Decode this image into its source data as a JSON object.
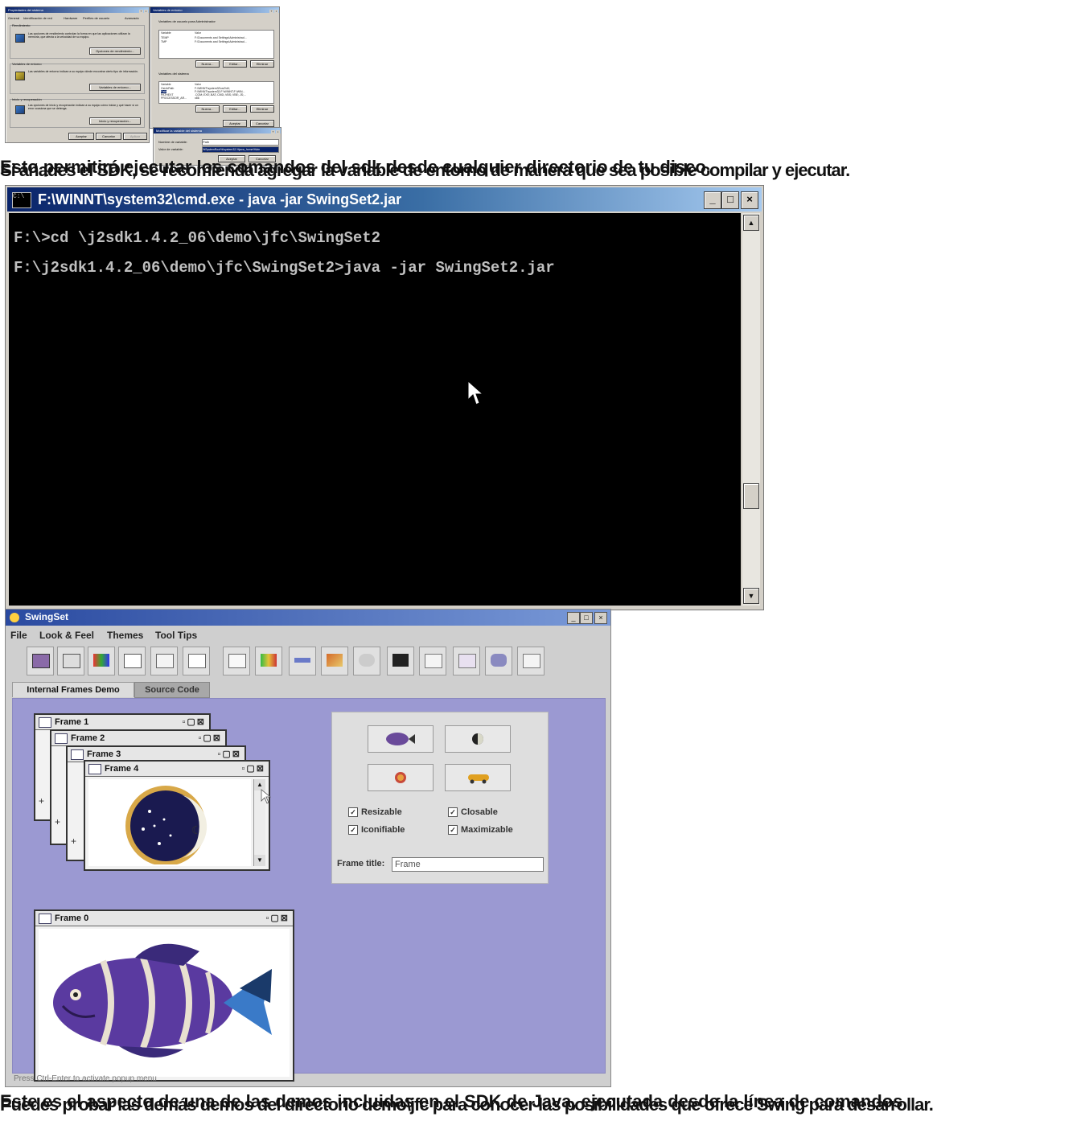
{
  "top_dialogs": {
    "system_properties": {
      "title": "Propiedades del sistema",
      "tabs": [
        "General",
        "Identificación de red",
        "Hardware",
        "Perfiles de usuario",
        "Avanzado"
      ],
      "performance_label": "Rendimiento",
      "performance_text": "Las opciones de rendimiento controlan la forma en que las aplicaciones utilizan la memoria, que afecta a la velocidad de su equipo.",
      "performance_button": "Opciones de rendimiento...",
      "env_label": "Variables de entorno",
      "env_text": "Las variables de entorno indican a su equipo dónde encontrar cierto tipo de información.",
      "env_button": "Variables de entorno...",
      "startup_label": "Inicio y recuperación",
      "startup_text": "Las opciones de inicio y recuperación indican a su equipo cómo iniciar y qué hacer si un error ocasiona que se detenga.",
      "startup_button": "Inicio y recuperación...",
      "ok": "Aceptar",
      "cancel": "Cancelar",
      "apply": "Aplicar"
    },
    "env_vars": {
      "title": "Variables de entorno",
      "user_label": "Variables de usuario para Administrador",
      "col_variable": "Variable",
      "col_value": "Valor",
      "user_rows": [
        {
          "name": "TEMP",
          "value": "F:\\Documents and Settings\\Administrad..."
        },
        {
          "name": "TMP",
          "value": "F:\\Documents and Settings\\Administrad..."
        }
      ],
      "new": "Nueva...",
      "edit": "Editar...",
      "delete": "Eliminar",
      "system_label": "Variables del sistema",
      "system_rows": [
        {
          "name": "OsLibPath",
          "value": "F:\\WINNT\\system32\\os2\\dll;"
        },
        {
          "name": "Path",
          "value": "F:\\WINNT\\system32;F:\\WINNT;F:\\WIN..."
        },
        {
          "name": "PATHEXT",
          "value": ".COM;.EXE;.BAT;.CMD;.VBS;.VBE;.JS;..."
        },
        {
          "name": "PROCESSOR_AR...",
          "value": "x86"
        }
      ],
      "ok": "Aceptar",
      "cancel": "Cancelar"
    },
    "edit_var": {
      "title": "Modificar la variable del sistema",
      "name_label": "Nombre de variable:",
      "name_value": "Path",
      "value_label": "Valor de variable:",
      "value_value": "%SystemRoot%\\system32;%java_home%\\bin",
      "ok": "Aceptar",
      "cancel": "Cancelar"
    }
  },
  "paragraph_top": {
    "line1": "Esto permitirá ejecutar los comandos del sdk desde cualquier directorio de tu disco.",
    "line2": "Si añades el SDK, se recomienda agregar la variable de entorno de manera que sea posible compilar y ejecutar."
  },
  "cmd_window": {
    "title": "F:\\WINNT\\system32\\cmd.exe - java -jar SwingSet2.jar",
    "lines": [
      "F:\\>cd \\j2sdk1.4.2_06\\demo\\jfc\\SwingSet2",
      "F:\\j2sdk1.4.2_06\\demo\\jfc\\SwingSet2>java -jar SwingSet2.jar"
    ]
  },
  "swingset": {
    "title": "SwingSet",
    "menus": [
      "File",
      "Look & Feel",
      "Themes",
      "Tool Tips"
    ],
    "tabs": [
      "Internal Frames Demo",
      "Source Code"
    ],
    "frames": [
      "Frame 1",
      "Frame 2",
      "Frame 3",
      "Frame 4",
      "Frame 0"
    ],
    "checks": [
      "Resizable",
      "Closable",
      "Iconifiable",
      "Maximizable"
    ],
    "frame_title_label": "Frame title:",
    "frame_title_value": "Frame",
    "status": "Press Ctrl-Enter to activate popup menu"
  },
  "paragraph_bottom": {
    "line1": "Este es el aspecto de una de las demos incluidas en el SDK de Java, ejecutada desde la línea de comandos.",
    "line2": "Puedes probar las demás demos del directorio demo\\jfc para conocer las posibilidades que ofrece Swing para desarrollar."
  },
  "colors": {
    "desktop": "#9b99d2",
    "titlebar": "#0a246a",
    "console_bg": "#000000",
    "console_fg": "#c0c0c0"
  }
}
